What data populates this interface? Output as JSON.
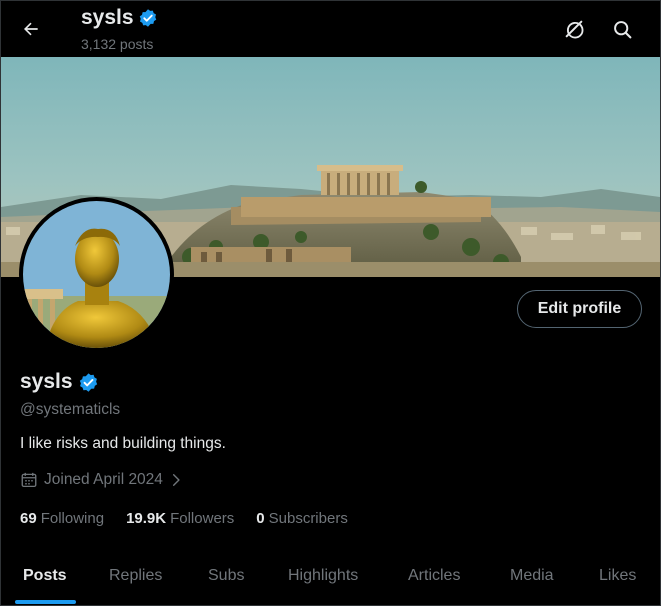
{
  "header": {
    "title": "sysls",
    "post_count": "3,132 posts"
  },
  "profile": {
    "name": "sysls",
    "handle": "@systematicls",
    "bio": "I like risks and building things.",
    "joined": "Joined April 2024",
    "edit_label": "Edit profile",
    "verified": true
  },
  "stats": {
    "following": {
      "count": "69",
      "label": "Following"
    },
    "followers": {
      "count": "19.9K",
      "label": "Followers"
    },
    "subscribers": {
      "count": "0",
      "label": "Subscribers"
    }
  },
  "tabs": [
    {
      "label": "Posts",
      "active": true
    },
    {
      "label": "Replies"
    },
    {
      "label": "Subs"
    },
    {
      "label": "Highlights"
    },
    {
      "label": "Articles"
    },
    {
      "label": "Media"
    },
    {
      "label": "Likes"
    }
  ],
  "icons": {
    "back": "arrow-left-icon",
    "grok": "grok-icon",
    "search": "search-icon",
    "verified": "verified-badge-icon",
    "calendar": "calendar-icon",
    "chevron": "chevron-right-icon"
  },
  "colors": {
    "background": "#000000",
    "accent": "#1d9bf0",
    "text": "#e7e9ea",
    "muted": "#71767b"
  }
}
